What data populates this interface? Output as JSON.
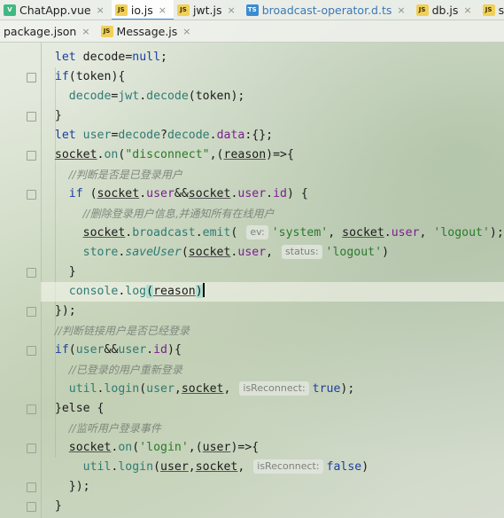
{
  "tabs_row1": [
    {
      "label": "ChatApp.vue",
      "type": "vue",
      "active": false
    },
    {
      "label": "io.js",
      "type": "js",
      "active": true
    },
    {
      "label": "jwt.js",
      "type": "js",
      "active": false
    },
    {
      "label": "broadcast-operator.d.ts",
      "type": "ts",
      "active": false
    },
    {
      "label": "db.js",
      "type": "js",
      "active": false
    },
    {
      "label": "store.js",
      "type": "js",
      "active": false
    }
  ],
  "tabs_row2": [
    {
      "label": "package.json",
      "type": "json",
      "active": false
    },
    {
      "label": "Message.js",
      "type": "js",
      "active": false
    }
  ],
  "file_icon_labels": {
    "js": "JS",
    "ts": "TS",
    "vue": "V"
  },
  "close_glyph": "×",
  "code": {
    "kw_let": "let",
    "kw_if": "if",
    "kw_else": "}else {",
    "decode": "decode",
    "null": "null",
    "token": "token",
    "jwt": "jwt",
    "user": "user",
    "data": "data",
    "socket": "socket",
    "on": "on",
    "disconnect": "\"disconnect\"",
    "reason": "reason",
    "id": "id",
    "broadcast": "broadcast",
    "emit": "emit",
    "system": "'system'",
    "logout": "'logout'",
    "store": "store",
    "saveUser": "saveUser",
    "console": "console",
    "log": "log",
    "util": "util",
    "login": "login",
    "true": "true",
    "false": "false",
    "login_str": "'login'",
    "comment1": "//判断是否是已登录用户",
    "comment2": "//删除登录用户信息,并通知所有在线用户",
    "comment3": "//判断链接用户是否已经登录",
    "comment4": "//已登录的用户重新登录",
    "comment5": "//监听用户登录事件",
    "hint_ev": "ev:",
    "hint_status": "status:",
    "hint_isReconnect": "isReconnect:"
  }
}
